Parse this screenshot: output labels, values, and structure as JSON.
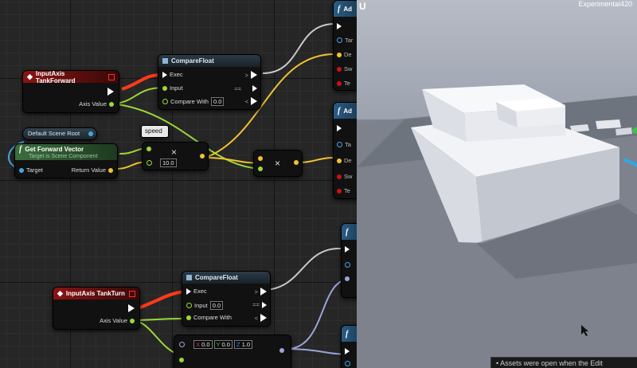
{
  "viewport": {
    "title": "Experimental420",
    "logo": "U",
    "notification": "Assets were open when the Edit"
  },
  "nodes": {
    "tank_forward": {
      "title": "InputAxis TankForward",
      "axis_value": "Axis Value"
    },
    "compare_float_1": {
      "title": "CompareFloat",
      "exec": "Exec",
      "input": "Input",
      "compare_with": "Compare With",
      "compare_with_value": "0.0"
    },
    "default_scene_root": {
      "title": "Default Scene Root"
    },
    "get_forward_vector": {
      "title": "Get Forward Vector",
      "subtitle": "Target is Scene Component",
      "target": "Target",
      "return_value": "Return Value"
    },
    "speed": {
      "title": "speed"
    },
    "multiply_1": {
      "symbol": "×",
      "value": "10.0"
    },
    "multiply_2": {
      "symbol": "×"
    },
    "tank_turn": {
      "title": "InputAxis TankTurn",
      "axis_value": "Axis Value"
    },
    "compare_float_2": {
      "title": "CompareFloat",
      "exec": "Exec",
      "input": "Input",
      "input_value": "0.0",
      "compare_with": "Compare With"
    },
    "make_rotator": {
      "x_label": "X",
      "x_value": "0.0",
      "y_label": "Y",
      "y_value": "0.0",
      "z_label": "Z",
      "z_value": "1.0"
    },
    "add_1": {
      "title": "Ad",
      "pins": [
        "Tar",
        "De",
        "Sw",
        "Te"
      ]
    },
    "add_2": {
      "title": "Ad",
      "pins": [
        "Ta",
        "De",
        "Sw",
        "Te"
      ]
    }
  },
  "colors": {
    "exec": "#ffffff",
    "float": "#9bd83a",
    "vector": "#f1c232",
    "object": "#48a3e3",
    "rotator": "#9aa5d8",
    "wire_grey": "#c8c8c8",
    "marker": "#e32222"
  },
  "icons": {
    "function": "function-icon",
    "event": "event-icon",
    "delegate": "delegate-icon"
  }
}
